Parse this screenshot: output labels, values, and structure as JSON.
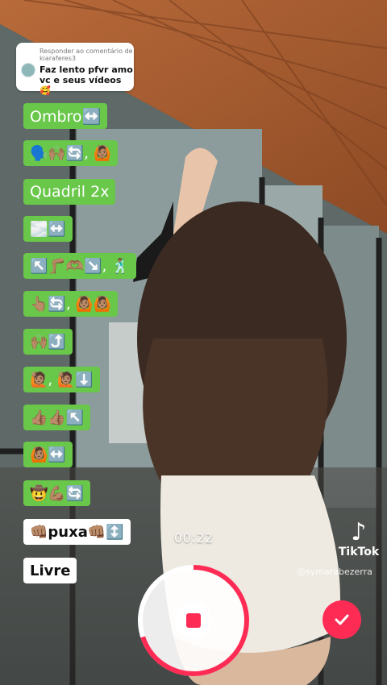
{
  "comment": {
    "reply_label": "Responder ao comentário de kiaraferes3",
    "text": "Faz lento pfvr amo vc e seus vídeos 🥰"
  },
  "steps": [
    {
      "label": "Ombro↔️"
    },
    {
      "label": "🗣️🙌🏽🔄, 🙆🏽"
    },
    {
      "label": "Quadril 2x"
    },
    {
      "label": "🌫️↔️"
    },
    {
      "label": "↖️🦵🏽🫶🏽↘️, 🕺🏽"
    },
    {
      "label": "👆🏽🔄, 🙆🏽🙆🏽"
    },
    {
      "label": "🙌🏽⤴️"
    },
    {
      "label": "🙋🏽, 🙋🏽⬇️"
    },
    {
      "label": "👍🏽👍🏽↖️"
    },
    {
      "label": "🙆🏽↔️"
    },
    {
      "label": "🤠💪🏽🔄"
    },
    {
      "label": "👊🏽puxa👊🏽↕️"
    },
    {
      "label": "Livre"
    }
  ],
  "recording": {
    "timer": "00:22",
    "progress": 0.7
  },
  "watermark": {
    "brand": "TikTok",
    "handle": "@symarabezerra"
  },
  "colors": {
    "accent": "#fe2c55",
    "chip_green": "#69c74a"
  }
}
